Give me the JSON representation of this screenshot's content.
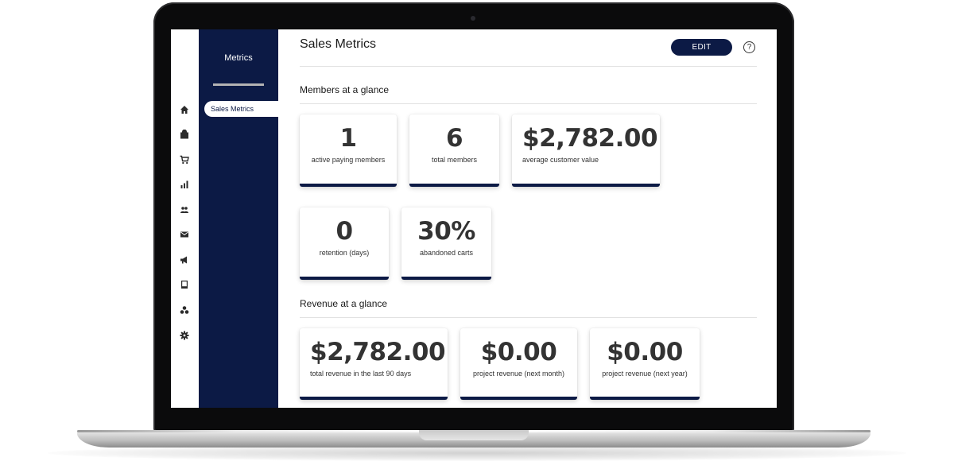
{
  "sidebar": {
    "title": "Metrics",
    "active_item": "Sales Metrics",
    "rail_icons": [
      "home-icon",
      "store-icon",
      "cart-icon",
      "bar-chart-icon",
      "people-icon",
      "mail-icon",
      "megaphone-icon",
      "book-icon",
      "circles-icon",
      "gear-icon"
    ]
  },
  "header": {
    "title": "Sales Metrics",
    "edit_label": "EDIT",
    "help_label": "?"
  },
  "members_section": {
    "title": "Members at a glance",
    "cards": [
      {
        "value": "1",
        "label": "active paying members"
      },
      {
        "value": "6",
        "label": "total members"
      },
      {
        "value": "$2,782.00",
        "label": "average customer value"
      },
      {
        "value": "0",
        "label": "retention (days)"
      },
      {
        "value": "30%",
        "label": "abandoned carts"
      }
    ]
  },
  "revenue_section": {
    "title": "Revenue at a glance",
    "cards": [
      {
        "value": "$2,782.00",
        "label": "total revenue in the last 90 days"
      },
      {
        "value": "$0.00",
        "label": "project revenue (next month)"
      },
      {
        "value": "$0.00",
        "label": "project revenue (next year)"
      }
    ]
  },
  "colors": {
    "nav_background": "#0c1a45",
    "accent": "#0c1a45",
    "card_value": "#333333"
  }
}
